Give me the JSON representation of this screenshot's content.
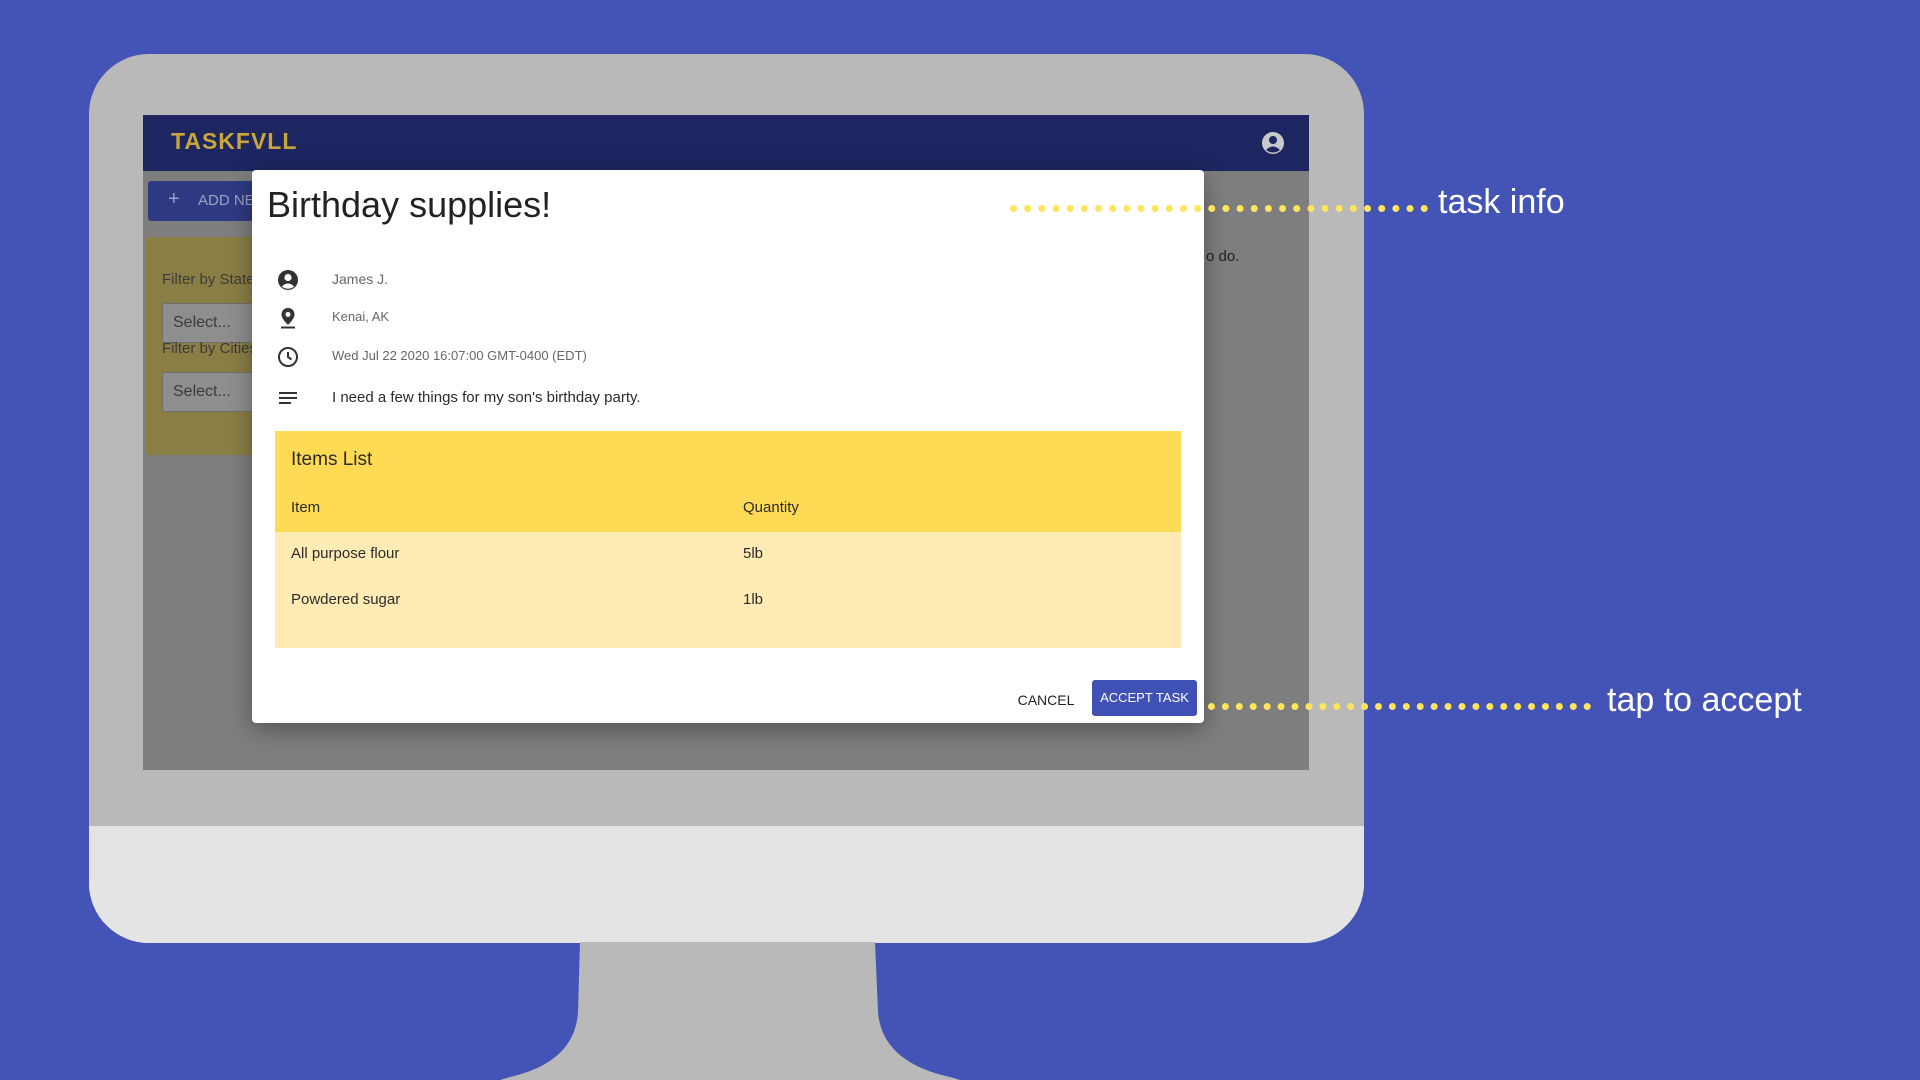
{
  "app": {
    "logo": "TASKFVLL",
    "add_button_label": "ADD NEW",
    "filters": {
      "state_label": "Filter by State",
      "state_placeholder": "Select...",
      "cities_label": "Filter by Cities",
      "cities_placeholder": "Select..."
    },
    "background_text": "o do."
  },
  "dialog": {
    "title": "Birthday supplies!",
    "requester": "James J.",
    "location": "Kenai, AK",
    "datetime": "Wed Jul 22 2020 16:07:00 GMT-0400 (EDT)",
    "description": "I need a few things for my son's birthday party.",
    "items_list": {
      "title": "Items List",
      "columns": [
        "Item",
        "Quantity"
      ],
      "rows": [
        {
          "item": "All purpose flour",
          "quantity": "5lb"
        },
        {
          "item": "Powdered sugar",
          "quantity": "1lb"
        }
      ]
    },
    "cancel_label": "CANCEL",
    "accept_label": "ACCEPT TASK"
  },
  "annotations": {
    "task_info": "task info",
    "tap_to_accept": "tap to accept"
  },
  "icons": {
    "account": "account-circle-icon",
    "person": "person-icon",
    "location": "location-pin-icon",
    "time": "clock-icon",
    "description": "notes-icon",
    "add": "plus-icon"
  },
  "colors": {
    "background": "#4453b6",
    "appbar": "#1d2660",
    "accent": "#3f51b5",
    "items_header": "#ffda55",
    "items_body": "#ffebb3",
    "annotation_dots": "#ffe45c"
  }
}
